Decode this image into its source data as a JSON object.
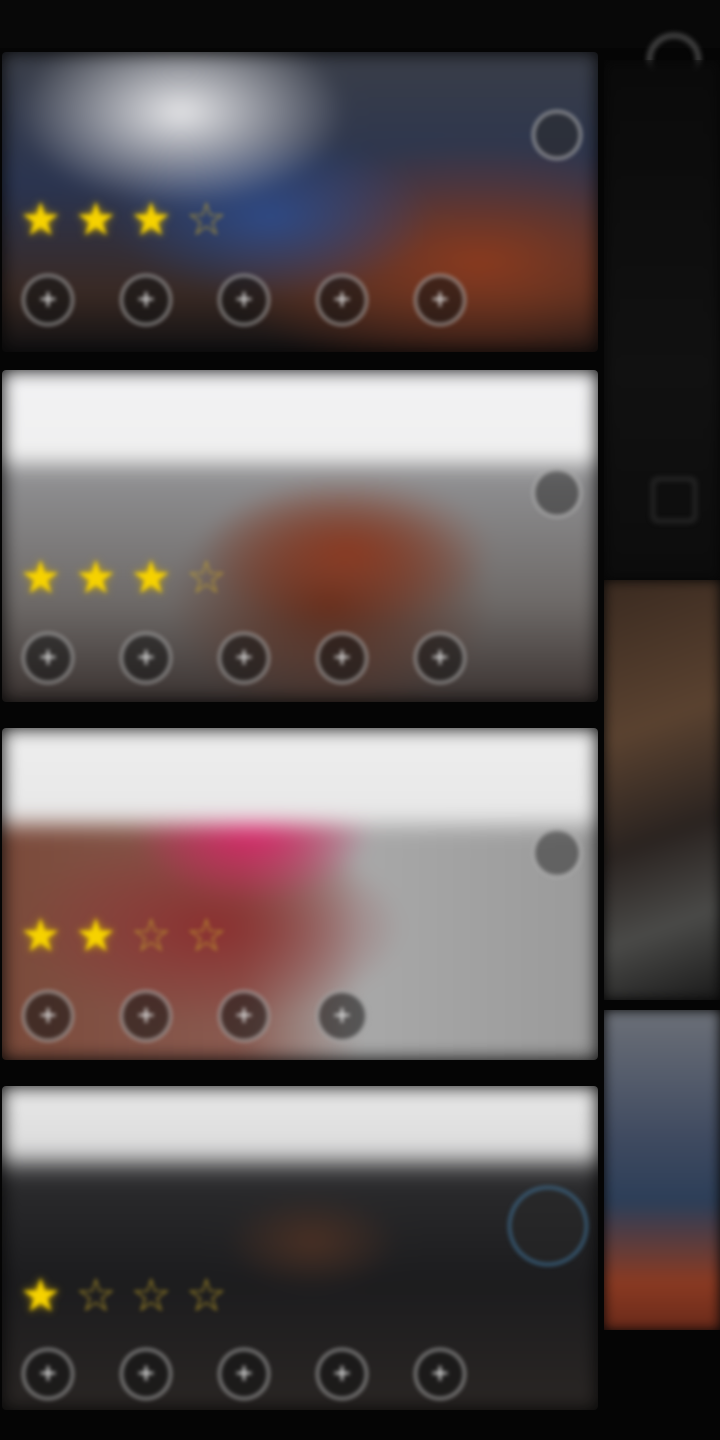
{
  "top_tabs": [
    "",
    "",
    ""
  ],
  "cards": [
    {
      "title": "",
      "stars_full": 3,
      "stars_total": 4,
      "actions": [
        "+",
        "+",
        "+",
        "+",
        "+"
      ],
      "has_badge": true,
      "badge_text": ""
    },
    {
      "title": "",
      "stars_full": 3,
      "stars_total": 4,
      "actions": [
        "+",
        "+",
        "+",
        "+",
        "+"
      ],
      "has_badge": true,
      "badge_text": ""
    },
    {
      "title": "",
      "stars_full": 2,
      "stars_total": 4,
      "actions": [
        "+",
        "+",
        "+",
        "+"
      ],
      "has_badge": true,
      "badge_text": ""
    },
    {
      "title": "",
      "stars_full": 1,
      "stars_total": 4,
      "actions": [
        "+",
        "+",
        "+",
        "+",
        "+"
      ],
      "has_badge": true,
      "badge_text": ""
    }
  ],
  "bottom_hint": "",
  "colors": {
    "star": "#f6d200",
    "background": "#050505"
  },
  "icons": {
    "star": "star-icon",
    "action": "plus-icon",
    "settings": "gear-icon"
  }
}
